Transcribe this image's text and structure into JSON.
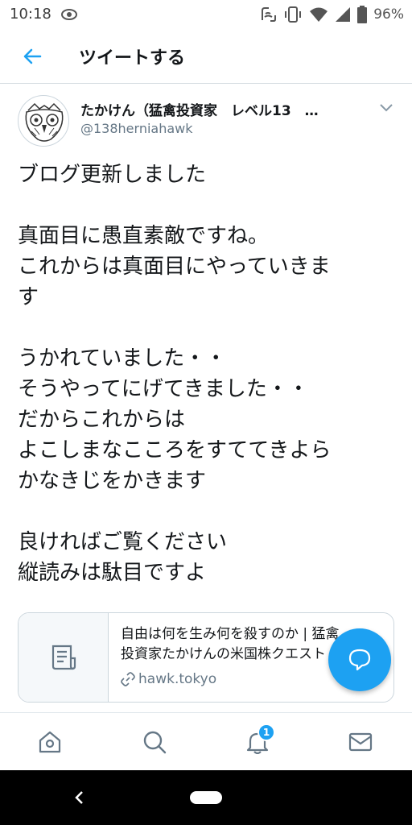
{
  "status_bar": {
    "time": "10:18",
    "battery": "96%"
  },
  "app_bar": {
    "title": "ツイートする"
  },
  "tweet": {
    "display_name": "たかけん（猛禽投資家　レベル13　…",
    "handle": "@138herniahawk",
    "lines": [
      "ブログ更新しました",
      "",
      "真面目に愚直素敵ですね。",
      "これからは真面目にやっていきま",
      "す",
      "",
      "うかれていました・・",
      "そうやってにげてきました・・",
      "だからこれからは",
      "よこしまなこころをすててきよら",
      "かなきじをかきます",
      "",
      "良ければご覧ください",
      "縦読みは駄目ですよ"
    ]
  },
  "link_card": {
    "title_line1": "自由は何を生み何を殺すのか | 猛禽",
    "title_line2": "投資家たかけんの米国株クエスト",
    "domain": "hawk.tokyo"
  },
  "bottom_nav": {
    "notifications_badge": "1"
  },
  "icons": {
    "accent_color": "#1da1f2"
  }
}
